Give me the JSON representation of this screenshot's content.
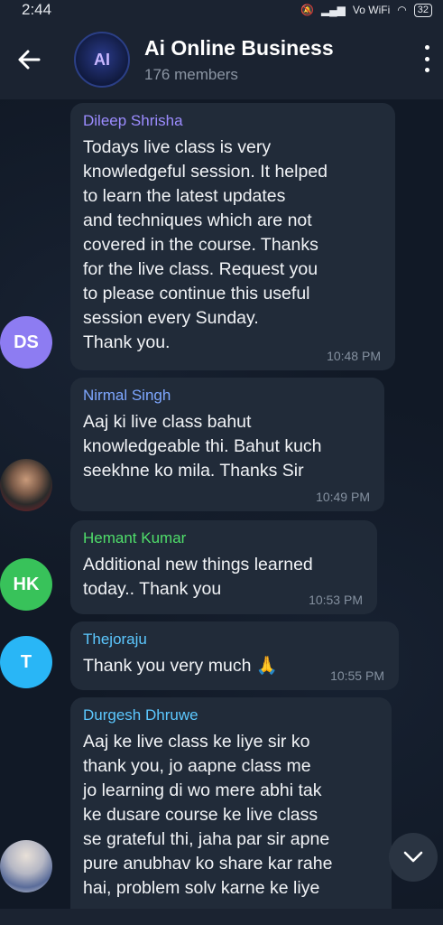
{
  "status": {
    "time": "2:44",
    "indicators": "Vo WiFi",
    "battery": "32"
  },
  "header": {
    "avatar_text": "AI",
    "title": "Ai Online Business",
    "subtitle": "176 members"
  },
  "messages": [
    {
      "sender": "Dileep Shrisha",
      "sender_color": "#9c8cff",
      "avatar_text": "DS",
      "avatar_color": "#8d7cf2",
      "text": "Todays live class is very\nknowledgeful session. It helped\nto learn the latest updates\nand techniques which are not\ncovered in the course. Thanks\nfor the live class. Request you\nto please continue this useful\nsession every Sunday.\nThank you.",
      "time": "10:48 PM"
    },
    {
      "sender": "Nirmal Singh",
      "sender_color": "#7ea7ff",
      "avatar_text": "",
      "text": "Aaj ki live class bahut\nknowledgeable thi. Bahut kuch\nseekhne ko mila. Thanks Sir",
      "time": "10:49 PM"
    },
    {
      "sender": "Hemant Kumar",
      "sender_color": "#4fdd6a",
      "avatar_text": "HK",
      "avatar_color": "#38c25a",
      "text": "Additional new things learned\ntoday.. Thank you",
      "time": "10:53 PM"
    },
    {
      "sender": "Thejoraju",
      "sender_color": "#5cc8ff",
      "avatar_text": "T",
      "avatar_color": "#29b6f6",
      "text": "Thank you very much 🙏",
      "time": "10:55 PM"
    },
    {
      "sender": "Durgesh Dhruwe",
      "sender_color": "#5cc8ff",
      "avatar_text": "",
      "text": "Aaj ke live  class ke liye sir ko\nthank you, jo aapne class me\njo learning di wo mere abhi tak\nke dusare course ke live class\nse grateful thi, jaha par sir apne\npure anubhav ko share kar rahe\nhai, problem solv karne ke liye",
      "time": ""
    }
  ]
}
